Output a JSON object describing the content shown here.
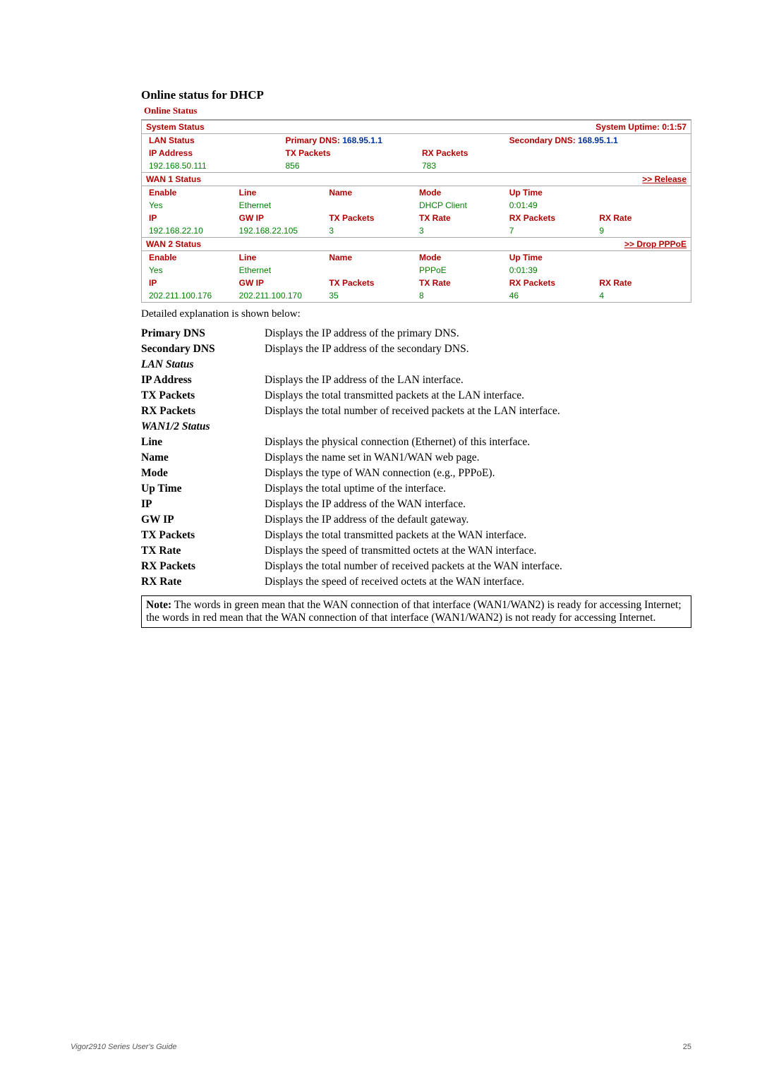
{
  "section_title": "Online status for DHCP",
  "panel_title": "Online Status",
  "system_status": {
    "label": "System Status",
    "uptime_label": "System Uptime:",
    "uptime_value": "0:1:57"
  },
  "lan_status": {
    "label": "LAN Status",
    "primary_dns_label": "Primary DNS:",
    "primary_dns_value": "168.95.1.1",
    "secondary_dns_label": "Secondary DNS:",
    "secondary_dns_value": "168.95.1.1",
    "ip_address_label": "IP Address",
    "ip_address_value": "192.168.50.111",
    "tx_packets_label": "TX Packets",
    "tx_packets_value": "856",
    "rx_packets_label": "RX Packets",
    "rx_packets_value": "783"
  },
  "wan1": {
    "label": "WAN 1 Status",
    "action": ">> Release",
    "h_enable": "Enable",
    "h_line": "Line",
    "h_name": "Name",
    "h_mode": "Mode",
    "h_uptime": "Up Time",
    "v_enable": "Yes",
    "v_line": "Ethernet",
    "v_name": "",
    "v_mode": "DHCP Client",
    "v_uptime": "0:01:49",
    "h_ip": "IP",
    "h_gwip": "GW IP",
    "h_tx_packets": "TX Packets",
    "h_tx_rate": "TX Rate",
    "h_rx_packets": "RX Packets",
    "h_rx_rate": "RX Rate",
    "v_ip": "192.168.22.10",
    "v_gwip": "192.168.22.105",
    "v_tx_packets": "3",
    "v_tx_rate": "3",
    "v_rx_packets": "7",
    "v_rx_rate": "9"
  },
  "wan2": {
    "label": "WAN 2 Status",
    "action": ">> Drop PPPoE",
    "h_enable": "Enable",
    "h_line": "Line",
    "h_name": "Name",
    "h_mode": "Mode",
    "h_uptime": "Up Time",
    "v_enable": "Yes",
    "v_line": "Ethernet",
    "v_name": "",
    "v_mode": "PPPoE",
    "v_uptime": "0:01:39",
    "h_ip": "IP",
    "h_gwip": "GW IP",
    "h_tx_packets": "TX Packets",
    "h_tx_rate": "TX Rate",
    "h_rx_packets": "RX Packets",
    "h_rx_rate": "RX Rate",
    "v_ip": "202.211.100.176",
    "v_gwip": "202.211.100.170",
    "v_tx_packets": "35",
    "v_tx_rate": "8",
    "v_rx_packets": "46",
    "v_rx_rate": "4"
  },
  "explain_intro": "Detailed explanation is shown below:",
  "defs": [
    {
      "term": "Primary DNS",
      "bold": true,
      "italic": false,
      "desc": "Displays the IP address of the primary DNS."
    },
    {
      "term": "Secondary DNS",
      "bold": true,
      "italic": false,
      "desc": "Displays the IP address of the secondary DNS."
    },
    {
      "term": "LAN Status",
      "bold": true,
      "italic": true,
      "desc": ""
    },
    {
      "term": "IP Address",
      "bold": true,
      "italic": false,
      "desc": "Displays the IP address of the LAN interface."
    },
    {
      "term": "TX Packets",
      "bold": true,
      "italic": false,
      "desc": "Displays the total transmitted packets at the LAN interface."
    },
    {
      "term": "RX Packets",
      "bold": true,
      "italic": false,
      "desc": "Displays the total number of received packets at the LAN interface."
    },
    {
      "term": "WAN1/2 Status",
      "bold": true,
      "italic": true,
      "desc": ""
    },
    {
      "term": "Line",
      "bold": true,
      "italic": false,
      "desc": "Displays the physical connection (Ethernet) of this interface."
    },
    {
      "term": "Name",
      "bold": true,
      "italic": false,
      "desc": "Displays the name set in WAN1/WAN web page."
    },
    {
      "term": "Mode",
      "bold": true,
      "italic": false,
      "desc": "Displays the type of WAN connection (e.g., PPPoE)."
    },
    {
      "term": "Up Time",
      "bold": true,
      "italic": false,
      "desc": "Displays the total uptime of the interface."
    },
    {
      "term": "IP",
      "bold": true,
      "italic": false,
      "desc": "Displays the IP address of the WAN interface."
    },
    {
      "term": "GW IP",
      "bold": true,
      "italic": false,
      "desc": "Displays the IP address of the default gateway."
    },
    {
      "term": "TX Packets",
      "bold": true,
      "italic": false,
      "desc": "Displays the total transmitted packets at the WAN interface."
    },
    {
      "term": "TX Rate",
      "bold": true,
      "italic": false,
      "desc": "Displays the speed of transmitted octets at the WAN interface."
    },
    {
      "term": "RX Packets",
      "bold": true,
      "italic": false,
      "desc": "Displays the total number of received packets at the WAN interface."
    },
    {
      "term": "RX Rate",
      "bold": true,
      "italic": false,
      "desc": "Displays the speed of received octets at the WAN interface."
    }
  ],
  "note_label": "Note:",
  "note_body": " The words in green mean that the WAN connection of that interface (WAN1/WAN2) is ready for accessing Internet; the words in red mean that the WAN connection of that interface (WAN1/WAN2) is not ready for accessing Internet.",
  "footer_left": "Vigor2910 Series User's Guide",
  "footer_right": "25"
}
